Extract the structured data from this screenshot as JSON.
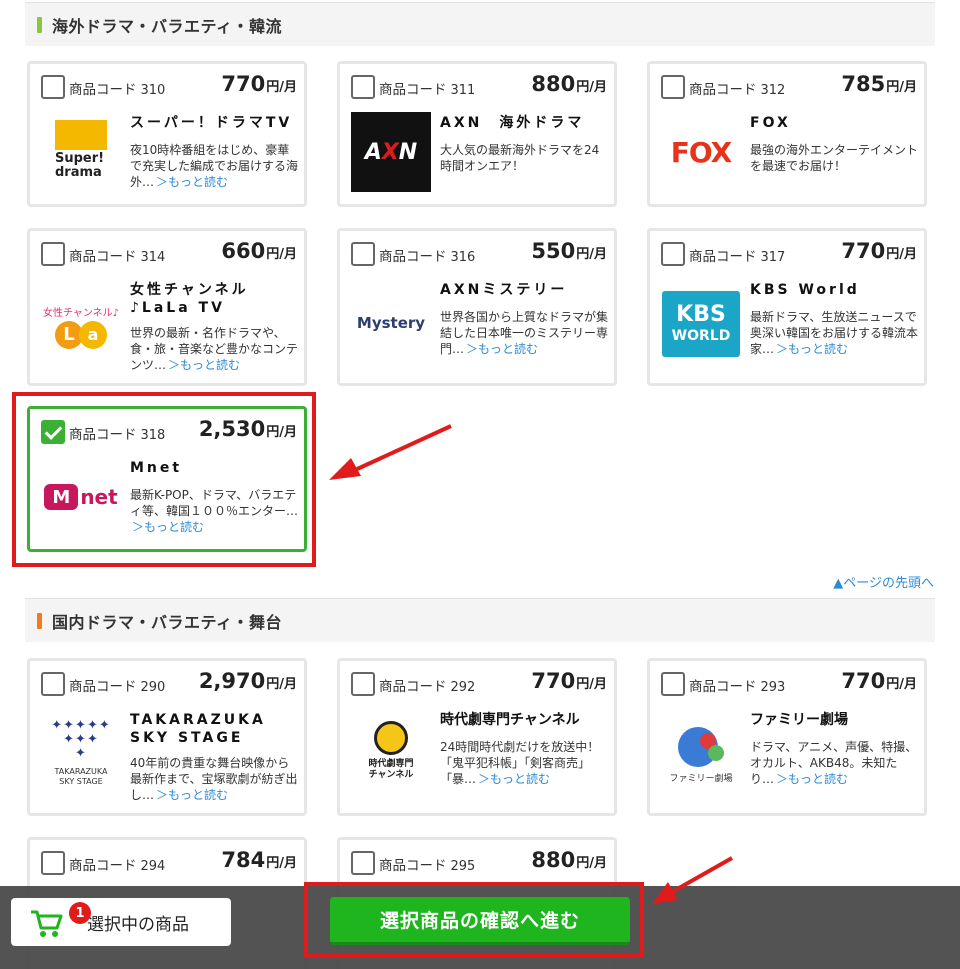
{
  "sections": {
    "overseas": {
      "title": "海外ドラマ・バラエティ・韓流",
      "bar_color": "#8cc63f"
    },
    "domestic": {
      "title": "国内ドラマ・バラエティ・舞台",
      "bar_color": "#f07c1e"
    }
  },
  "code_label": "商品コード",
  "price_unit": "円/月",
  "more_label": "＞もっと読む",
  "page_top": "▲ページの先頭へ",
  "cards": [
    {
      "code": "310",
      "price": "770",
      "name": "スーパー！ドラマTV",
      "desc": "夜10時枠番組をはじめ、豪華で充実した編成でお届けする海外…",
      "logo": "Super! drama",
      "checked": false
    },
    {
      "code": "311",
      "price": "880",
      "name": "AXN　海外ドラマ",
      "desc": "大人気の最新海外ドラマを24時間オンエア！",
      "logo": "AXN",
      "checked": false
    },
    {
      "code": "312",
      "price": "785",
      "name": "FOX",
      "desc": "最強の海外エンターテイメントを最速でお届け！",
      "logo": "FOX",
      "checked": false
    },
    {
      "code": "314",
      "price": "660",
      "name": "女性チャンネル♪LaLa TV",
      "desc": "世界の最新・名作ドラマや、食・旅・音楽など豊かなコンテンツ…",
      "logo": "LaLa TV",
      "logo_sub": "女性チャンネル♪",
      "checked": false
    },
    {
      "code": "316",
      "price": "550",
      "name": "AXNミステリー",
      "desc": "世界各国から上質なドラマが集結した日本唯一のミステリー専門…",
      "logo": "Mystery",
      "checked": false
    },
    {
      "code": "317",
      "price": "770",
      "name": "KBS World",
      "desc": "最新ドラマ、生放送ニュースで奥深い韓国をお届けする韓流本家…",
      "logo_top": "KBS",
      "logo_bottom": "WORLD",
      "checked": false
    },
    {
      "code": "318",
      "price": "2,530",
      "name": "Mnet",
      "desc": "最新K-POP、ドラマ、バラエティ等、韓国１００％エンター…",
      "logo": "M net",
      "checked": true
    },
    {
      "code": "290",
      "price": "2,970",
      "name": "TAKARAZUKA SKY STAGE",
      "desc": "40年前の貴重な舞台映像から最新作まで、宝塚歌劇が紡ぎ出し…",
      "logo_line1": "TAKARAZUKA",
      "logo_line2": "SKY STAGE",
      "checked": false
    },
    {
      "code": "292",
      "price": "770",
      "name": "時代劇専門チャンネル",
      "desc": "24時間時代劇だけを放送中！「鬼平犯科帳」「剣客商売」「暴…",
      "logo_line1": "時代劇専門",
      "logo_line2": "チャンネル",
      "checked": false
    },
    {
      "code": "293",
      "price": "770",
      "name": "ファミリー劇場",
      "desc": "ドラマ、アニメ、声優、特撮、オカルト、AKB48。未知たり…",
      "logo": "ファミリー劇場",
      "checked": false
    },
    {
      "code": "294",
      "price": "784",
      "name": "",
      "desc": "",
      "checked": false
    },
    {
      "code": "295",
      "price": "880",
      "name": "",
      "desc": "",
      "checked": false
    }
  ],
  "footer": {
    "cart_label": "選択中の商品",
    "cart_count": "1",
    "proceed_label": "選択商品の確認へ進む"
  },
  "colors": {
    "accent_green": "#3cb034",
    "highlight_red": "#e01b1b",
    "link_blue": "#2d8bd3"
  }
}
